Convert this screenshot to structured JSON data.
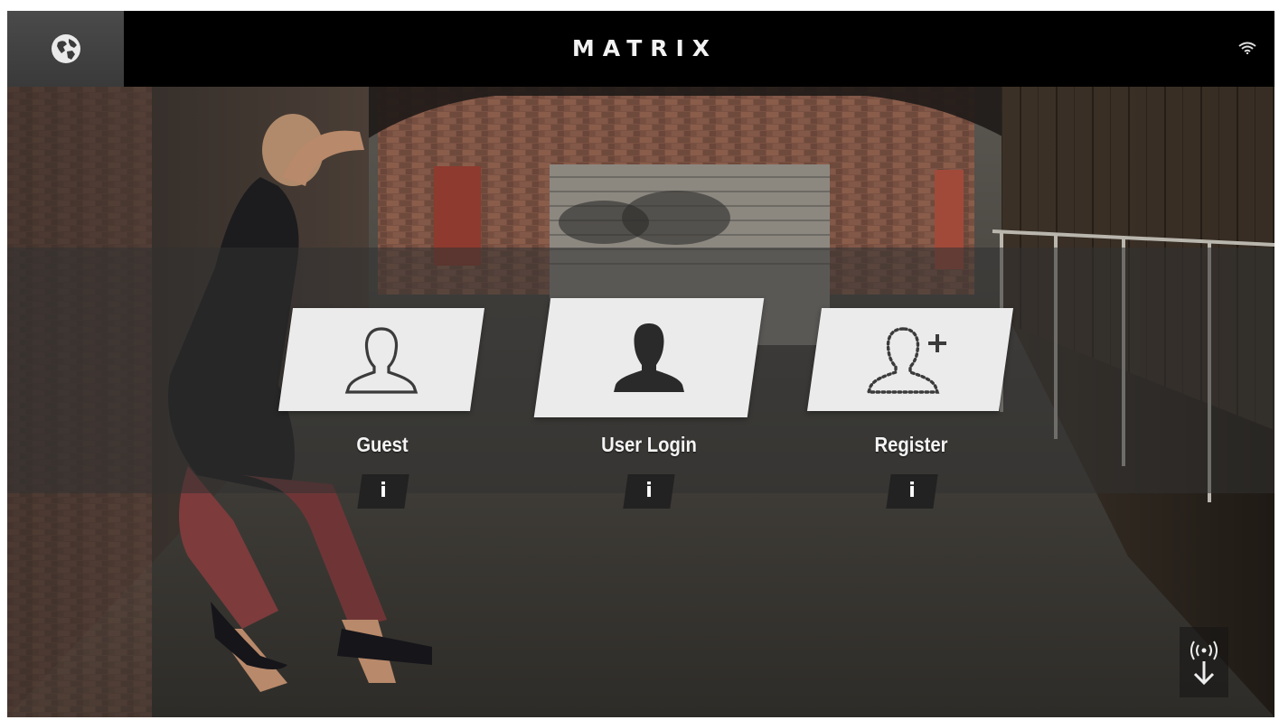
{
  "header": {
    "logo_text": "MATRIX",
    "language_icon": "globe-icon",
    "wifi_icon": "wifi-icon"
  },
  "options": [
    {
      "label": "Guest",
      "icon": "user-outline-icon",
      "info_label": "i"
    },
    {
      "label": "User Login",
      "icon": "user-solid-icon",
      "info_label": "i"
    },
    {
      "label": "Register",
      "icon": "user-add-icon",
      "info_label": "i"
    }
  ],
  "footer": {
    "wireless_icon": "wireless-download-icon"
  },
  "colors": {
    "topbar": "#000000",
    "card": "#ebebeb",
    "info_button": "#222222",
    "logo_accent": "#e0202a"
  }
}
